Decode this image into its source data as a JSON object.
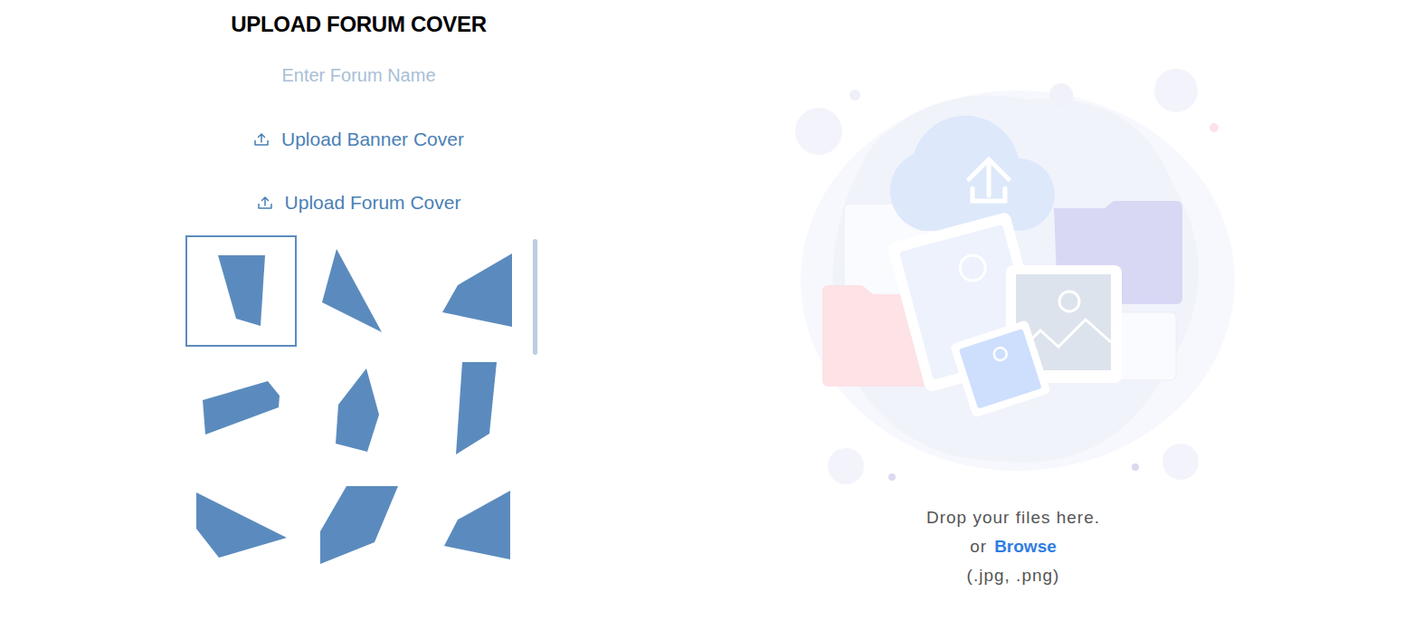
{
  "page": {
    "title": "UPLOAD FORUM COVER"
  },
  "form": {
    "forum_name_placeholder": "Enter Forum Name"
  },
  "upload_buttons": [
    {
      "label": "Upload Banner Cover"
    },
    {
      "label": "Upload Forum Cover"
    }
  ],
  "cover_shapes": [
    {
      "selected": true
    },
    {
      "selected": false
    },
    {
      "selected": false
    },
    {
      "selected": false
    },
    {
      "selected": false
    },
    {
      "selected": false
    },
    {
      "selected": false
    },
    {
      "selected": false
    },
    {
      "selected": false
    }
  ],
  "shapes_scrollbar": {
    "level": 0.35
  },
  "dropzone": {
    "hint": "Drop your files here.",
    "or": "or",
    "browse": "Browse",
    "formats": "(.jpg, .png)"
  }
}
